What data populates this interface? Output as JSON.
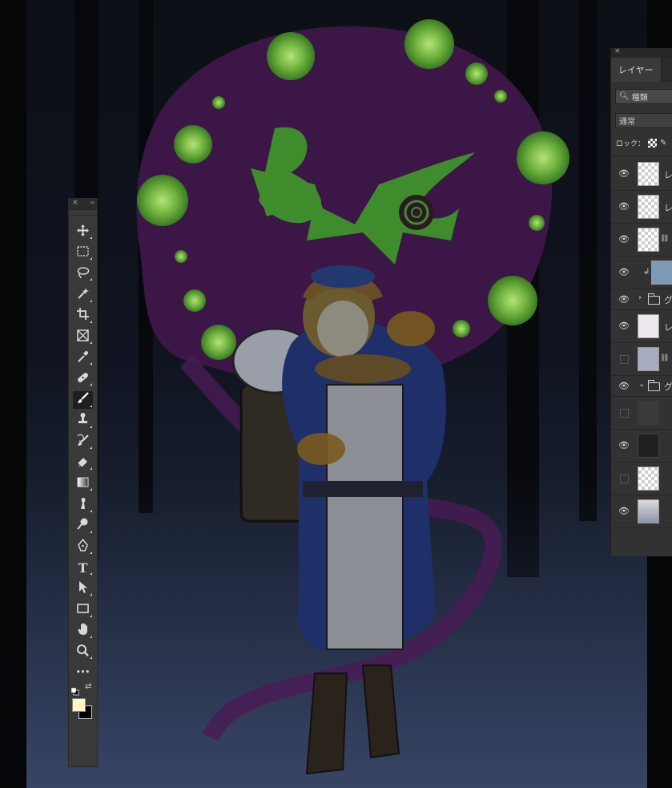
{
  "canvas": {
    "description_icon": "artwork-canvas"
  },
  "tools_panel": {
    "close_glyph": "×",
    "expand_glyph": "››",
    "tools": [
      {
        "name": "move-tool",
        "icon": "move-icon"
      },
      {
        "name": "marquee-tool",
        "icon": "marquee-icon"
      },
      {
        "name": "lasso-tool",
        "icon": "lasso-icon"
      },
      {
        "name": "magic-wand-tool",
        "icon": "magic-wand-icon"
      },
      {
        "name": "crop-tool",
        "icon": "crop-icon"
      },
      {
        "name": "frame-tool",
        "icon": "frame-icon"
      },
      {
        "name": "eyedropper-tool",
        "icon": "eyedropper-icon"
      },
      {
        "name": "healing-brush-tool",
        "icon": "bandage-icon"
      },
      {
        "name": "brush-tool",
        "icon": "brush-icon",
        "active": true
      },
      {
        "name": "clone-stamp-tool",
        "icon": "stamp-icon"
      },
      {
        "name": "history-brush-tool",
        "icon": "history-brush-icon"
      },
      {
        "name": "eraser-tool",
        "icon": "eraser-icon"
      },
      {
        "name": "gradient-tool",
        "icon": "gradient-icon"
      },
      {
        "name": "smudge-tool",
        "icon": "smudge-icon"
      },
      {
        "name": "dodge-tool",
        "icon": "dodge-icon"
      },
      {
        "name": "pen-tool",
        "icon": "pen-icon"
      },
      {
        "name": "type-tool",
        "icon": "type-icon",
        "label": "T"
      },
      {
        "name": "path-selection-tool",
        "icon": "arrow-icon"
      },
      {
        "name": "rectangle-tool",
        "icon": "rectangle-icon"
      },
      {
        "name": "hand-tool",
        "icon": "hand-icon"
      },
      {
        "name": "zoom-tool",
        "icon": "zoom-icon"
      },
      {
        "name": "more-tools",
        "icon": "ellipsis-icon",
        "label": "•••"
      }
    ],
    "foreground_color": "#fff6c8",
    "background_color": "#000000",
    "swap_glyph": "⇄"
  },
  "layers_panel": {
    "close_glyph": "×",
    "tab_label": "レイヤー",
    "filter_label": "種類",
    "blend_mode": "通常",
    "lock_label": "ロック：",
    "layers": [
      {
        "visible": true,
        "name": "レ",
        "thumb": "transparent"
      },
      {
        "visible": true,
        "name": "レ",
        "thumb": "transparent"
      },
      {
        "visible": true,
        "name": "",
        "thumb": "sketch",
        "linked": true
      },
      {
        "visible": true,
        "name": "",
        "thumb": "blue-figure",
        "clipped": true
      },
      {
        "visible": true,
        "name": "グ",
        "type": "group",
        "expanded": false
      },
      {
        "visible": true,
        "name": "レ",
        "thumb": "purple-ghost"
      },
      {
        "visible": false,
        "name": "",
        "thumb": "grey-fill",
        "linked": true
      },
      {
        "visible": true,
        "name": "グ",
        "type": "group",
        "expanded": true
      },
      {
        "visible": false,
        "name": "",
        "thumb": "grass"
      },
      {
        "visible": true,
        "name": "",
        "thumb": "dark"
      },
      {
        "visible": false,
        "name": "",
        "thumb": "gradient"
      },
      {
        "visible": true,
        "name": "",
        "thumb": "gradient-dark"
      }
    ]
  }
}
